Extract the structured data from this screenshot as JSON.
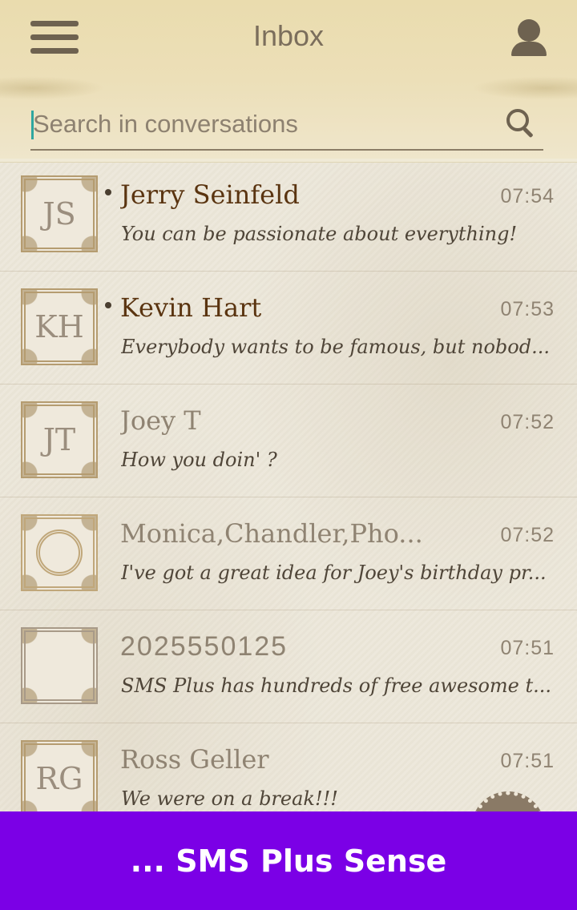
{
  "header": {
    "title": "Inbox",
    "menu_icon": "hamburger-menu-icon",
    "profile_icon": "person-icon"
  },
  "search": {
    "placeholder": "Search in conversations",
    "value": "",
    "icon": "search-icon"
  },
  "conversations": [
    {
      "initials": "JS",
      "name": "Jerry Seinfeld",
      "time": "07:54",
      "message": "You can be passionate about everything!",
      "unread": true
    },
    {
      "initials": "KH",
      "name": "Kevin Hart",
      "time": "07:53",
      "message": "Everybody wants to be famous, but nobod...",
      "unread": true
    },
    {
      "initials": "JT",
      "name": "Joey T",
      "time": "07:52",
      "message": "How you doin' ?",
      "unread": false
    },
    {
      "initials": "",
      "name": "Monica,Chandler,Pho...",
      "time": "07:52",
      "message": "I've got a great idea for Joey's birthday pr...",
      "unread": false
    },
    {
      "initials": "",
      "name": "2025550125",
      "time": "07:51",
      "message": "SMS Plus has hundreds of free awesome t...",
      "unread": false
    },
    {
      "initials": "RG",
      "name": "Ross Geller",
      "time": "07:51",
      "message": "We were on a break!!!",
      "unread": false
    }
  ],
  "banner": {
    "text": "... SMS Plus Sense",
    "color": "#7b00e6"
  },
  "colors": {
    "header_bg": "#ecdfb8",
    "unread_name": "#5a3410",
    "read_name": "#8f8372",
    "accent_caret": "#2fa7a0"
  }
}
